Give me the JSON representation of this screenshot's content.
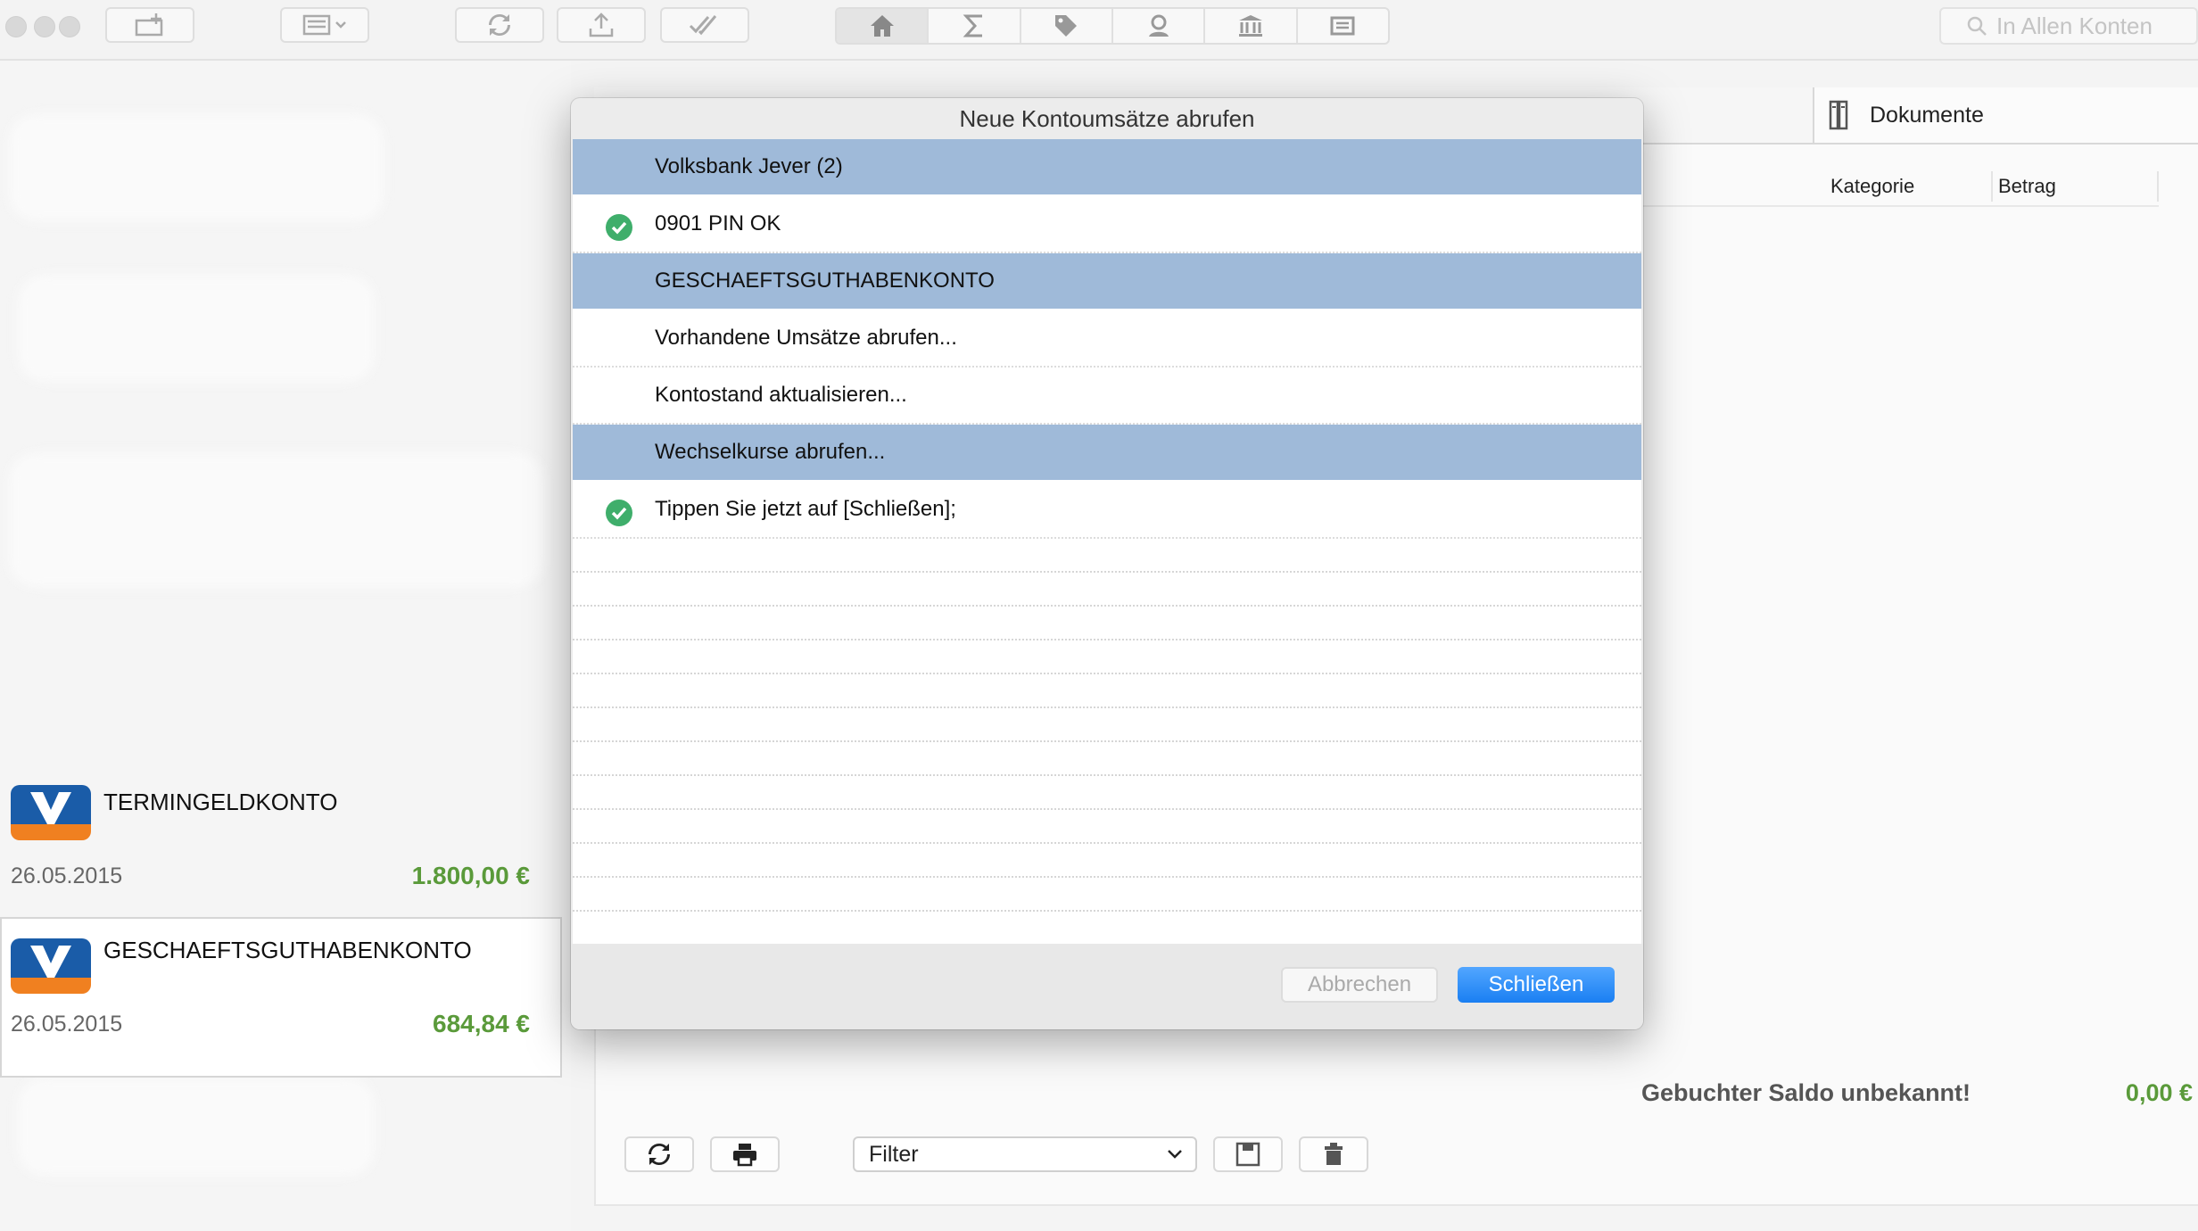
{
  "toolbar": {
    "search_placeholder": "In Allen Konten",
    "sections": [
      "home-icon",
      "sigma-icon",
      "tag-icon",
      "person-icon",
      "bank-icon",
      "card-reader-icon"
    ]
  },
  "accounts": [
    {
      "name": "TERMINGELDKONTO",
      "date": "26.05.2015",
      "balance": "1.800,00 €"
    },
    {
      "name": "GESCHAEFTSGUTHABENKONTO",
      "date": "26.05.2015",
      "balance": "684,84 €"
    }
  ],
  "main": {
    "documents_tab": "Dokumente",
    "columns": {
      "category": "Kategorie",
      "amount": "Betrag"
    },
    "saldo_label": "Gebuchter Saldo unbekannt!",
    "saldo_value": "0,00 €",
    "filter_value": "Filter"
  },
  "dialog": {
    "title": "Neue Kontoumsätze abrufen",
    "rows": [
      {
        "text": "Volksbank Jever (2)",
        "group": true,
        "check": false
      },
      {
        "text": "0901 PIN OK",
        "group": false,
        "check": true
      },
      {
        "text": "GESCHAEFTSGUTHABENKONTO",
        "group": true,
        "check": false
      },
      {
        "text": "Vorhandene Umsätze abrufen...",
        "group": false,
        "check": false
      },
      {
        "text": "Kontostand aktualisieren...",
        "group": false,
        "check": false
      },
      {
        "text": "Wechselkurse abrufen...",
        "group": true,
        "check": false
      },
      {
        "text": "Tippen Sie jetzt auf [Schließen];",
        "group": false,
        "check": true
      }
    ],
    "cancel_label": "Abbrechen",
    "close_label": "Schließen"
  },
  "colors": {
    "group_row": "#9fbad9",
    "check_green": "#3fae6b",
    "balance_green": "#5a9a3a",
    "primary_button": "#1a7ff2"
  }
}
